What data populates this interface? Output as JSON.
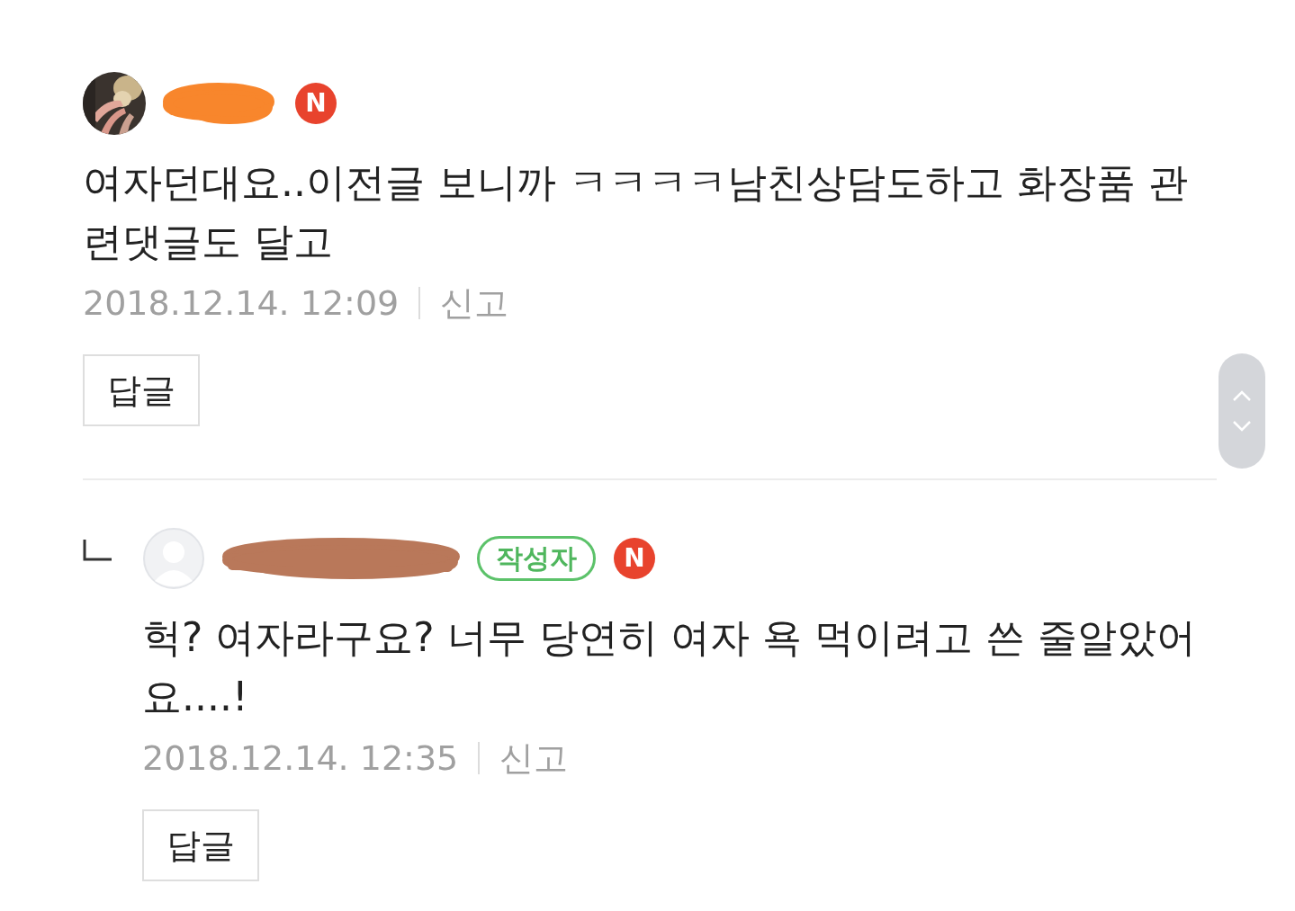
{
  "comments": [
    {
      "kind": "comment",
      "new_badge": "N",
      "body": "여자던대요..이전글 보니까 ㅋㅋㅋㅋ남친상담도하고 화장품 관련댓글도 달고",
      "date": "2018.12.14. 12:09",
      "report": "신고",
      "reply_button": "답글"
    },
    {
      "kind": "reply",
      "writer_badge": "작성자",
      "new_badge": "N",
      "body": "헉? 여자라구요? 너무 당연히 여자 욕 먹이려고 쓴 줄알았어요....!",
      "date": "2018.12.14. 12:35",
      "report": "신고",
      "reply_button": "답글"
    }
  ]
}
